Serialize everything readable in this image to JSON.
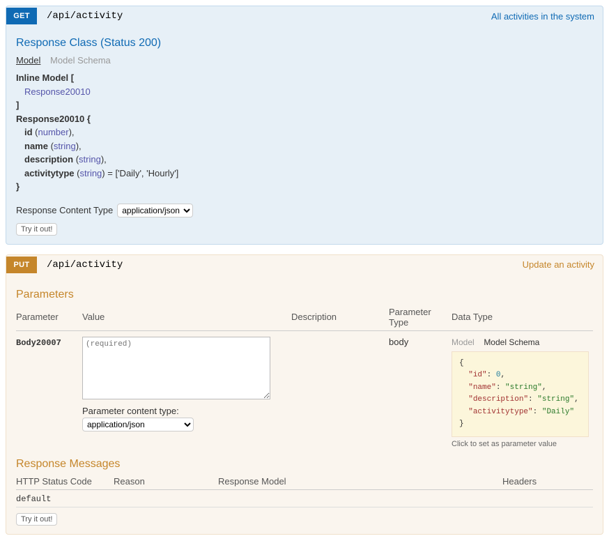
{
  "get": {
    "method": "GET",
    "path": "/api/activity",
    "summary": "All activities in the system",
    "response_class_title": "Response Class (Status 200)",
    "tabs": {
      "model": "Model",
      "schema": "Model Schema"
    },
    "model": {
      "inline_open": "Inline Model [",
      "inline_item": "Response20010",
      "inline_close": "]",
      "obj_open": "Response20010 {",
      "field_id_name": "id",
      "field_id_type": "number",
      "field_name_name": "name",
      "field_name_type": "string",
      "field_desc_name": "description",
      "field_desc_type": "string",
      "field_at_name": "activitytype",
      "field_at_type": "string",
      "field_at_enum": " = ['Daily', 'Hourly']",
      "obj_close": "}"
    },
    "rct_label": "Response Content Type",
    "rct_value": "application/json",
    "try_label": "Try it out!"
  },
  "put": {
    "method": "PUT",
    "path": "/api/activity",
    "summary": "Update an activity",
    "params_title": "Parameters",
    "headers": {
      "parameter": "Parameter",
      "value": "Value",
      "description": "Description",
      "ptype": "Parameter Type",
      "dtype": "Data Type"
    },
    "param": {
      "name": "Body20007",
      "placeholder": "(required)",
      "pct_label": "Parameter content type:",
      "pct_value": "application/json",
      "ptype": "body",
      "dt_tabs": {
        "model": "Model",
        "schema": "Model Schema"
      },
      "schema_id": "id",
      "schema_id_val": "0",
      "schema_name": "name",
      "schema_name_val": "\"string\"",
      "schema_desc": "description",
      "schema_desc_val": "\"string\"",
      "schema_at": "activitytype",
      "schema_at_val": "\"Daily\"",
      "schema_hint": "Click to set as parameter value"
    },
    "resp_msgs_title": "Response Messages",
    "resp_headers": {
      "code": "HTTP Status Code",
      "reason": "Reason",
      "model": "Response Model",
      "headers": "Headers"
    },
    "resp_default": "default",
    "try_label": "Try it out!"
  }
}
